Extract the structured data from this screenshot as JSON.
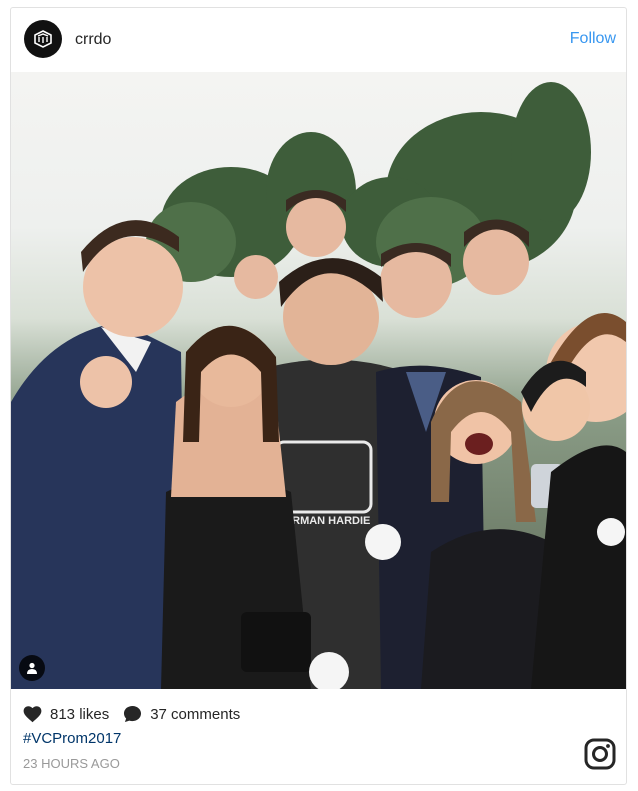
{
  "post": {
    "username": "crrdo",
    "follow_label": "Follow",
    "likes": "813 likes",
    "comments": "37 comments",
    "hashtag": "#VCProm2017",
    "timestamp": "23 HOURS AGO"
  },
  "icons": {
    "avatar": "crrdo-logo-icon",
    "tag": "person-tag-icon",
    "like": "heart-icon",
    "comment": "comment-bubble-icon",
    "brand": "instagram-icon"
  },
  "photo": {
    "shirt_text": "NORMAN HARDIE"
  },
  "colors": {
    "link": "#3897f0",
    "hashtag": "#003569",
    "muted": "#999999",
    "text": "#262626"
  }
}
